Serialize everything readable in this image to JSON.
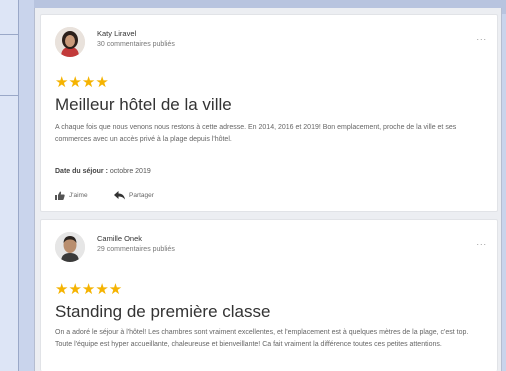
{
  "reviews": [
    {
      "author": "Katy Liravel",
      "comments": "30 commentaires publiés",
      "stars": "★★★★",
      "title": "Meilleur hôtel de la ville",
      "body": "A chaque fois que nous venons nous restons à cette adresse. En 2014, 2016 et 2019! Bon emplacement, proche de la ville et ses commerces avec un accès privé à la plage depuis l'hôtel.",
      "stay_label": "Date du séjour :",
      "stay_value": "octobre 2019",
      "like_label": "J'aime",
      "share_label": "Partager",
      "more": "..."
    },
    {
      "author": "Camille Onek",
      "comments": "29 commentaires publiés",
      "stars": "★★★★★",
      "title": "Standing de première classe",
      "body": "On a adoré le séjour à l'hôtel! Les chambres sont vraiment excellentes, et l'emplacement est à quelques mètres de la plage, c'est top. Toute l'équipe est hyper accueillante, chaleureuse et bienveillante! Ca fait vraiment la différence toutes ces petites attentions.",
      "more": "..."
    }
  ],
  "colors": {
    "star": "#f5b301",
    "background": "#c9d4ec"
  },
  "icons": [
    "thumbs-up-icon",
    "share-arrow-icon",
    "more-icon"
  ]
}
